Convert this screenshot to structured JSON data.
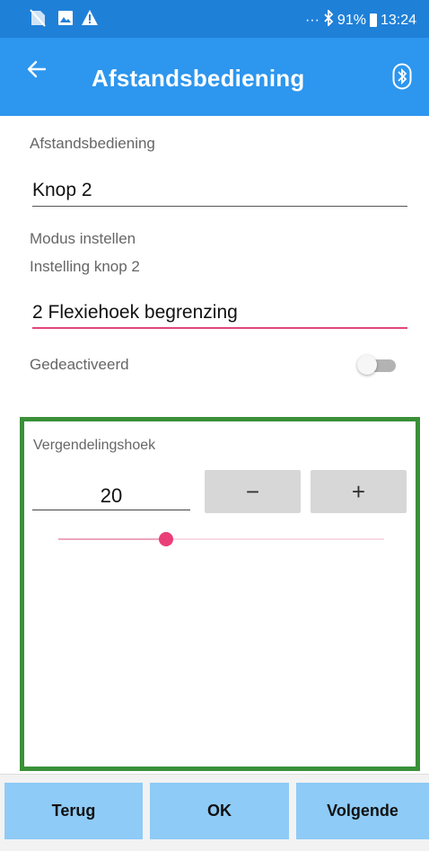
{
  "status_bar": {
    "icons": [
      "no-sim-icon",
      "image-icon",
      "warning-icon"
    ],
    "dots": "···",
    "bluetooth_icon": "bluetooth-icon",
    "battery": "91%",
    "time": "13:24"
  },
  "app_bar": {
    "title": "Afstandsbediening",
    "back_icon": "back-arrow-icon",
    "bluetooth_icon": "bluetooth-icon"
  },
  "form": {
    "remote_label": "Afstandsbediening",
    "remote_value": "Knop 2",
    "mode_label": "Modus instellen",
    "button_setting_label": "Instelling knop 2",
    "button_setting_value": "2 Flexiehoek begrenzing",
    "toggle_label": "Gedeactiveerd",
    "toggle_on": false
  },
  "panel": {
    "title": "Vergendelingshoek",
    "value": "20",
    "minus_label": "−",
    "plus_label": "+",
    "slider_fraction": 0.33
  },
  "bottom": {
    "back_label": "Terug",
    "ok_label": "OK",
    "next_label": "Volgende"
  },
  "colors": {
    "status_bar": "#1f80d8",
    "app_bar": "#2d96ee",
    "accent_pink": "#ea3e78",
    "panel_border": "#3a9038",
    "bottom_button": "#8ecbf6"
  }
}
